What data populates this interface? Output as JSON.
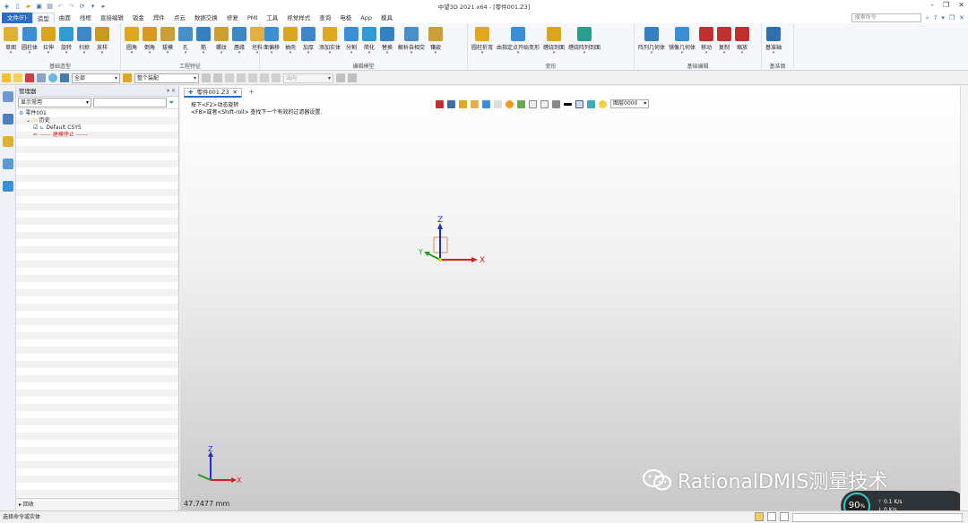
{
  "app": {
    "title": "中望3D 2021 x64 - [零件001.Z3]"
  },
  "menu": {
    "file_label": "文件(F)",
    "tabs": [
      "造型",
      "曲面",
      "线框",
      "直接编辑",
      "钣金",
      "焊件",
      "点云",
      "数据交换",
      "修复",
      "PMI",
      "工具",
      "视觉样式",
      "查询",
      "电极",
      "App",
      "模具"
    ],
    "active_tab": 0,
    "search_placeholder": "搜索命令"
  },
  "ribbon": {
    "groups": [
      {
        "label": "基础造型",
        "buttons": [
          {
            "label": "草图",
            "icon": "sketch-icon",
            "color": "#e0b030"
          },
          {
            "label": "圆柱体",
            "icon": "cylinder-icon",
            "color": "#3a8fd6"
          },
          {
            "label": "拉伸",
            "icon": "extrude-icon",
            "color": "#d9a520"
          },
          {
            "label": "旋转",
            "icon": "revolve-icon",
            "color": "#2f9bd0"
          },
          {
            "label": "扫掠",
            "icon": "sweep-icon",
            "color": "#3d87c8"
          },
          {
            "label": "放样",
            "icon": "loft-icon",
            "color": "#c89a20"
          }
        ]
      },
      {
        "label": "工程特征",
        "buttons": [
          {
            "label": "圆角",
            "icon": "fillet-icon",
            "color": "#e0a820"
          },
          {
            "label": "倒角",
            "icon": "chamfer-icon",
            "color": "#d89a1c"
          },
          {
            "label": "拔模",
            "icon": "draft-icon",
            "color": "#c9a035"
          },
          {
            "label": "孔",
            "icon": "hole-icon",
            "color": "#4a90c8"
          },
          {
            "label": "筋",
            "icon": "rib-icon",
            "color": "#3580c0"
          },
          {
            "label": "螺纹",
            "icon": "thread-icon",
            "color": "#caa030"
          },
          {
            "label": "唇缘",
            "icon": "lip-icon",
            "color": "#3b88c4"
          },
          {
            "label": "坯料",
            "icon": "stock-icon",
            "color": "#e0b040"
          }
        ]
      },
      {
        "label": "编辑模型",
        "buttons": [
          {
            "label": "面偏移",
            "icon": "face-offset-icon",
            "color": "#3a8fd6"
          },
          {
            "label": "抽壳",
            "icon": "shell-icon",
            "color": "#d9a520"
          },
          {
            "label": "加厚",
            "icon": "thicken-icon",
            "color": "#3d87c8"
          },
          {
            "label": "添加实体",
            "icon": "add-solid-icon",
            "color": "#e0a820"
          },
          {
            "label": "分割",
            "icon": "split-icon",
            "color": "#3a8fd6"
          },
          {
            "label": "简化",
            "icon": "simplify-icon",
            "color": "#2f9bd0"
          },
          {
            "label": "替换",
            "icon": "replace-icon",
            "color": "#3580c0"
          },
          {
            "label": "解析自相交",
            "icon": "self-intersect-icon",
            "color": "#4a90c8"
          },
          {
            "label": "镶嵌",
            "icon": "emboss-icon",
            "color": "#c9a035"
          }
        ]
      },
      {
        "label": "变形",
        "buttons": [
          {
            "label": "圆柱折弯",
            "icon": "cylinder-bend-icon",
            "color": "#e0a820"
          },
          {
            "label": "由指定点开始变形",
            "icon": "point-deform-icon",
            "color": "#3a8fd6"
          },
          {
            "label": "缠绕到面",
            "icon": "wrap-face-icon",
            "color": "#d9a520"
          },
          {
            "label": "缠绕阵列到面",
            "icon": "wrap-pattern-icon",
            "color": "#2a9d8f"
          }
        ]
      },
      {
        "label": "基础编辑",
        "buttons": [
          {
            "label": "阵列几何体",
            "icon": "pattern-icon",
            "color": "#3580c0"
          },
          {
            "label": "镜像几何体",
            "icon": "mirror-icon",
            "color": "#3a8fd6"
          },
          {
            "label": "移动",
            "icon": "move-icon",
            "color": "#c03030"
          },
          {
            "label": "复制",
            "icon": "copy-icon",
            "color": "#c03030"
          },
          {
            "label": "缩放",
            "icon": "scale-icon",
            "color": "#c03030"
          }
        ]
      },
      {
        "label": "基准面",
        "buttons": [
          {
            "label": "基准轴",
            "icon": "datum-axis-icon",
            "color": "#2f6fb0"
          }
        ]
      }
    ]
  },
  "toolbar": {
    "filter_value": "全部",
    "pick_value": "整个装配",
    "direction_value": "法向"
  },
  "manager": {
    "title": "管理器",
    "display_filter": "显示常用",
    "tree": [
      {
        "label": "零件001",
        "indent": 0,
        "icon": "part-icon"
      },
      {
        "label": "历史",
        "indent": 1,
        "icon": "folder-icon"
      },
      {
        "label": "Default CSYS",
        "indent": 2,
        "icon": "csys-icon"
      },
      {
        "label": "------ 建模停止 ------",
        "indent": 2,
        "icon": "stop-arrow-icon",
        "stop": true
      }
    ],
    "footer": "回收"
  },
  "viewport": {
    "doc_tab": "零件001.Z3",
    "hint_line1": "按下<F2>动态旋转",
    "hint_line2": "<F8>或者<Shift-roll> 查找下一个有效的过滤器设置.",
    "layer": "图层0000",
    "measure": "47.7477 mm",
    "axis_x": "X",
    "axis_y": "Y",
    "axis_z": "Z",
    "watermark": "RationalDMIS测量技术",
    "gauge_percent": "90",
    "gauge_percent_unit": "%",
    "gauge_up": "0.1",
    "gauge_up_unit": "K/s",
    "gauge_down": "0",
    "gauge_down_unit": "K/s"
  },
  "status": {
    "text": "选择命令或实体"
  }
}
